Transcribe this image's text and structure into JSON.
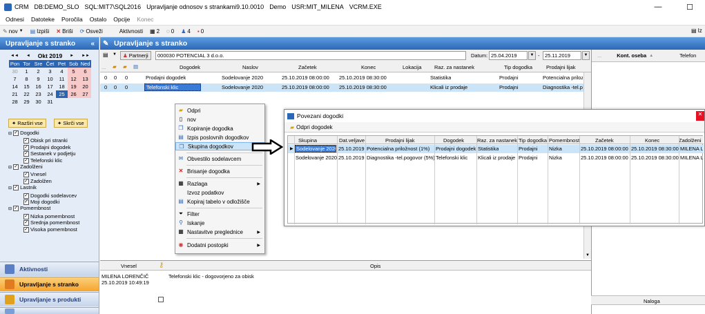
{
  "titlebar": {
    "app": "CRM",
    "db": "DB:DEMO_SLO",
    "sql": "SQL:MIT7\\SQL2016",
    "title": "Upravljanje odnosov s strankami9.10.0010",
    "mode": "Demo",
    "user": "USR:MIT_MILENA",
    "exe": "VCRM.EXE"
  },
  "menu": [
    "Odnesi",
    "Datoteke",
    "Poročila",
    "Ostalo",
    "Opcije",
    "Konec"
  ],
  "toolbar": {
    "new": "nov",
    "print": "Izpiši",
    "delete": "Briši",
    "refresh": "Osveži",
    "activities": "Aktivnosti",
    "count1": "2",
    "count2": "0",
    "count3": "4",
    "count4": "0",
    "right_label": "Iz"
  },
  "leftpane": {
    "title": "Upravljanje s stranko",
    "collapse": "«",
    "calendar": {
      "month": "Okt 2019",
      "prev2": "◄◄",
      "prev": "◄",
      "next": "►",
      "next2": "►►",
      "days": [
        "Pon",
        "Tor",
        "Sre",
        "Čet",
        "Pet",
        "Sob",
        "Ned"
      ],
      "weeks": [
        [
          "30",
          "1",
          "2",
          "3",
          "4",
          "5",
          "6"
        ],
        [
          "7",
          "8",
          "9",
          "10",
          "11",
          "12",
          "13"
        ],
        [
          "14",
          "15",
          "16",
          "17",
          "18",
          "19",
          "20"
        ],
        [
          "21",
          "22",
          "23",
          "24",
          "25",
          "26",
          "27"
        ],
        [
          "28",
          "29",
          "30",
          "31",
          "",
          "",
          ""
        ]
      ]
    },
    "expand_all": "Razširi vse",
    "collapse_all": "Skrči vse",
    "tree": [
      {
        "label": "Dogodki",
        "level": 1
      },
      {
        "label": "Obisk pri stranki",
        "level": 2
      },
      {
        "label": "Prodajni dogodek",
        "level": 2
      },
      {
        "label": "Sestanek v podjetju",
        "level": 2
      },
      {
        "label": "Telefonski klic",
        "level": 2
      },
      {
        "label": "Zadolženi",
        "level": 1
      },
      {
        "label": "Vnesel",
        "level": 2
      },
      {
        "label": "Zadolžen",
        "level": 2
      },
      {
        "label": "Lastnik",
        "level": 1
      },
      {
        "label": "Dogodki sodelavcev",
        "level": 2
      },
      {
        "label": "Moji dogodki",
        "level": 2
      },
      {
        "label": "Pomembnost",
        "level": 1
      },
      {
        "label": "Nizka pomembnost",
        "level": 2
      },
      {
        "label": "Srednja pomembnost",
        "level": 2
      },
      {
        "label": "Visoka pomembnost",
        "level": 2
      }
    ],
    "nav": [
      "Aktivnosti",
      "Upravljanje s stranko",
      "Upravljanje s produkti",
      ""
    ]
  },
  "main": {
    "title": "Upravljanje s stranko",
    "partner_btn": "Partnerji",
    "partner_value": "000030 POTENCIAL 3 d.o.o.",
    "date_label": "Datum:",
    "date_from": "25.04.2019",
    "date_sep": "-",
    "date_to": "25.11.2019",
    "columns": [
      "Dogodek",
      "Naslov",
      "Začetek",
      "Konec",
      "Lokacija",
      "Raz. za nastanek",
      "Tip dogodka",
      "Prodajni lijak"
    ],
    "rows": [
      {
        "c1": "0",
        "c2": "0",
        "c3": "0",
        "dogodek": "Prodajni dogodek",
        "naslov": "Sodelovanje 2020",
        "zacetek": "25.10.2019 08:00:00",
        "konec": "25.10.2019 08:30:00",
        "lokacija": "",
        "razlog": "Statistika",
        "tip": "Prodajni",
        "lijak": "Potencialna priloz"
      },
      {
        "c1": "0",
        "c2": "0",
        "c3": "0",
        "dogodek": "Telefonski klic",
        "naslov": "Sodelovanje 2020",
        "zacetek": "25.10.2019 08:00:00",
        "konec": "25.10.2019 08:30:00",
        "lokacija": "",
        "razlog": "Klicali iz prodaje",
        "tip": "Prodajni",
        "lijak": "Diagnostika -tel.p"
      }
    ]
  },
  "right": {
    "col1": "Kont. oseba",
    "col2": "Telefon",
    "naloga": "Naloga"
  },
  "bottom": {
    "col_vnesel": "Vnesel",
    "col_opis": "Opis",
    "author": "MILENA LORENČIČ",
    "timestamp": "25.10.2019 10:49:19",
    "text": "Telefonski klic - dogovorjeno za obisk"
  },
  "context_menu": [
    "Odpri",
    "nov",
    "Kopiranje dogodka",
    "Izpis poslovnih dogodkov",
    "Skupina dogodkov",
    "Obvestilo sodelavcem",
    "Brisanje dogodka",
    "Razlaga",
    "Izvoz podatkov",
    "Kopiraj tabelo v odložišče",
    "Filter",
    "Iskanje",
    "Nastavitve preglednice",
    "Dodatni postopki"
  ],
  "popup": {
    "title": "Povezani dogodki",
    "open_btn": "Odpri dogodek",
    "columns": [
      "Skupina",
      "Dat.veljave",
      "Prodajni lijak",
      "Dogodek",
      "Raz. za nastanek",
      "Tip dogodka",
      "Pomembnost",
      "Začetek",
      "Konec",
      "Zadolženi"
    ],
    "rows": [
      [
        "Sodelovanje 2020",
        "25.10.2019",
        "Potencialna priložnost (1%)",
        "Prodajni dogodek",
        "Statistika",
        "Prodajni",
        "Nizka",
        "25.10.2019 08:00:00",
        "25.10.2019 08:30:00",
        "MILENA L"
      ],
      [
        "Sodelovanje 2020",
        "25.10.2019",
        "Diagnostika -tel.pogovor (5%)",
        "Telefonski klic",
        "Klicali iz prodaje",
        "Prodajni",
        "Nizka",
        "25.10.2019 08:00:00",
        "25.10.2019 08:30:00",
        "MILENA L"
      ]
    ]
  },
  "colors": {
    "header_blue": "#2c68b8",
    "nav_active": "#f6a42d",
    "selection": "#cce4f7"
  }
}
